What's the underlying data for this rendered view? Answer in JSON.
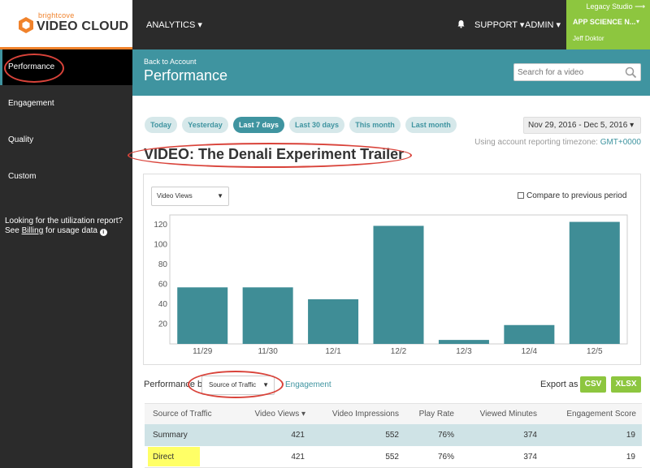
{
  "brand": {
    "small": "brightcove",
    "big": "VIDEO CLOUD",
    "accent": "#f0822b",
    "teal": "#3f94a0",
    "green": "#8dc63f"
  },
  "topnav": {
    "analytics": "ANALYTICS ▾",
    "support": "SUPPORT ▾",
    "admin": "ADMIN ▾",
    "legacy": "Legacy Studio ⟶",
    "account_name": "APP SCIENCE N...",
    "account_caret": "▾",
    "user_name": "Jeff Doktor"
  },
  "sidebar": {
    "items": [
      {
        "label": "Performance",
        "active": true
      },
      {
        "label": "Engagement"
      },
      {
        "label": "Quality"
      },
      {
        "label": "Custom"
      }
    ],
    "note_line1": "Looking for the utilization report?",
    "note_see": "See ",
    "note_link": "Billing",
    "note_rest": " for usage data ",
    "note_icon": "i"
  },
  "header": {
    "back": "Back to Account",
    "title": "Performance",
    "search_placeholder": "Search for a video"
  },
  "filters": {
    "ranges": [
      "Today",
      "Yesterday",
      "Last 7 days",
      "Last 30 days",
      "This month",
      "Last month"
    ],
    "active_index": 2,
    "date_range": "Nov 29, 2016 - Dec 5, 2016 ▾",
    "tz_text": "Using account reporting timezone: ",
    "tz_link": "GMT+0000"
  },
  "video": {
    "title": "VIDEO: The Denali Experiment Trailer"
  },
  "chart_controls": {
    "metric": "Video Views",
    "metric_caret": "▼",
    "compare": "Compare to previous period"
  },
  "chart_data": {
    "type": "bar",
    "categories": [
      "11/29",
      "11/30",
      "12/1",
      "12/2",
      "12/3",
      "12/4",
      "12/5"
    ],
    "values": [
      57,
      57,
      45,
      119,
      4,
      19,
      123
    ],
    "title": "",
    "xlabel": "",
    "ylabel": "",
    "ylim": [
      0,
      130
    ],
    "yticks": [
      20,
      40,
      60,
      80,
      100,
      120
    ],
    "grid": false,
    "bar_color": "#3f8d96"
  },
  "table_controls": {
    "perf_by": "Performance by",
    "dimension": "Source of Traffic",
    "dimension_caret": "▼",
    "engagement_link": "Engagement",
    "export_label": "Export as",
    "csv": "CSV",
    "xlsx": "XLSX"
  },
  "table": {
    "headers": [
      "Source of Traffic",
      "Video Views ▾",
      "Video Impressions",
      "Play Rate",
      "Viewed Minutes",
      "Engagement Score"
    ],
    "rows": [
      [
        "Summary",
        "421",
        "552",
        "76%",
        "374",
        "19"
      ],
      [
        "Direct",
        "421",
        "552",
        "76%",
        "374",
        "19"
      ]
    ]
  }
}
